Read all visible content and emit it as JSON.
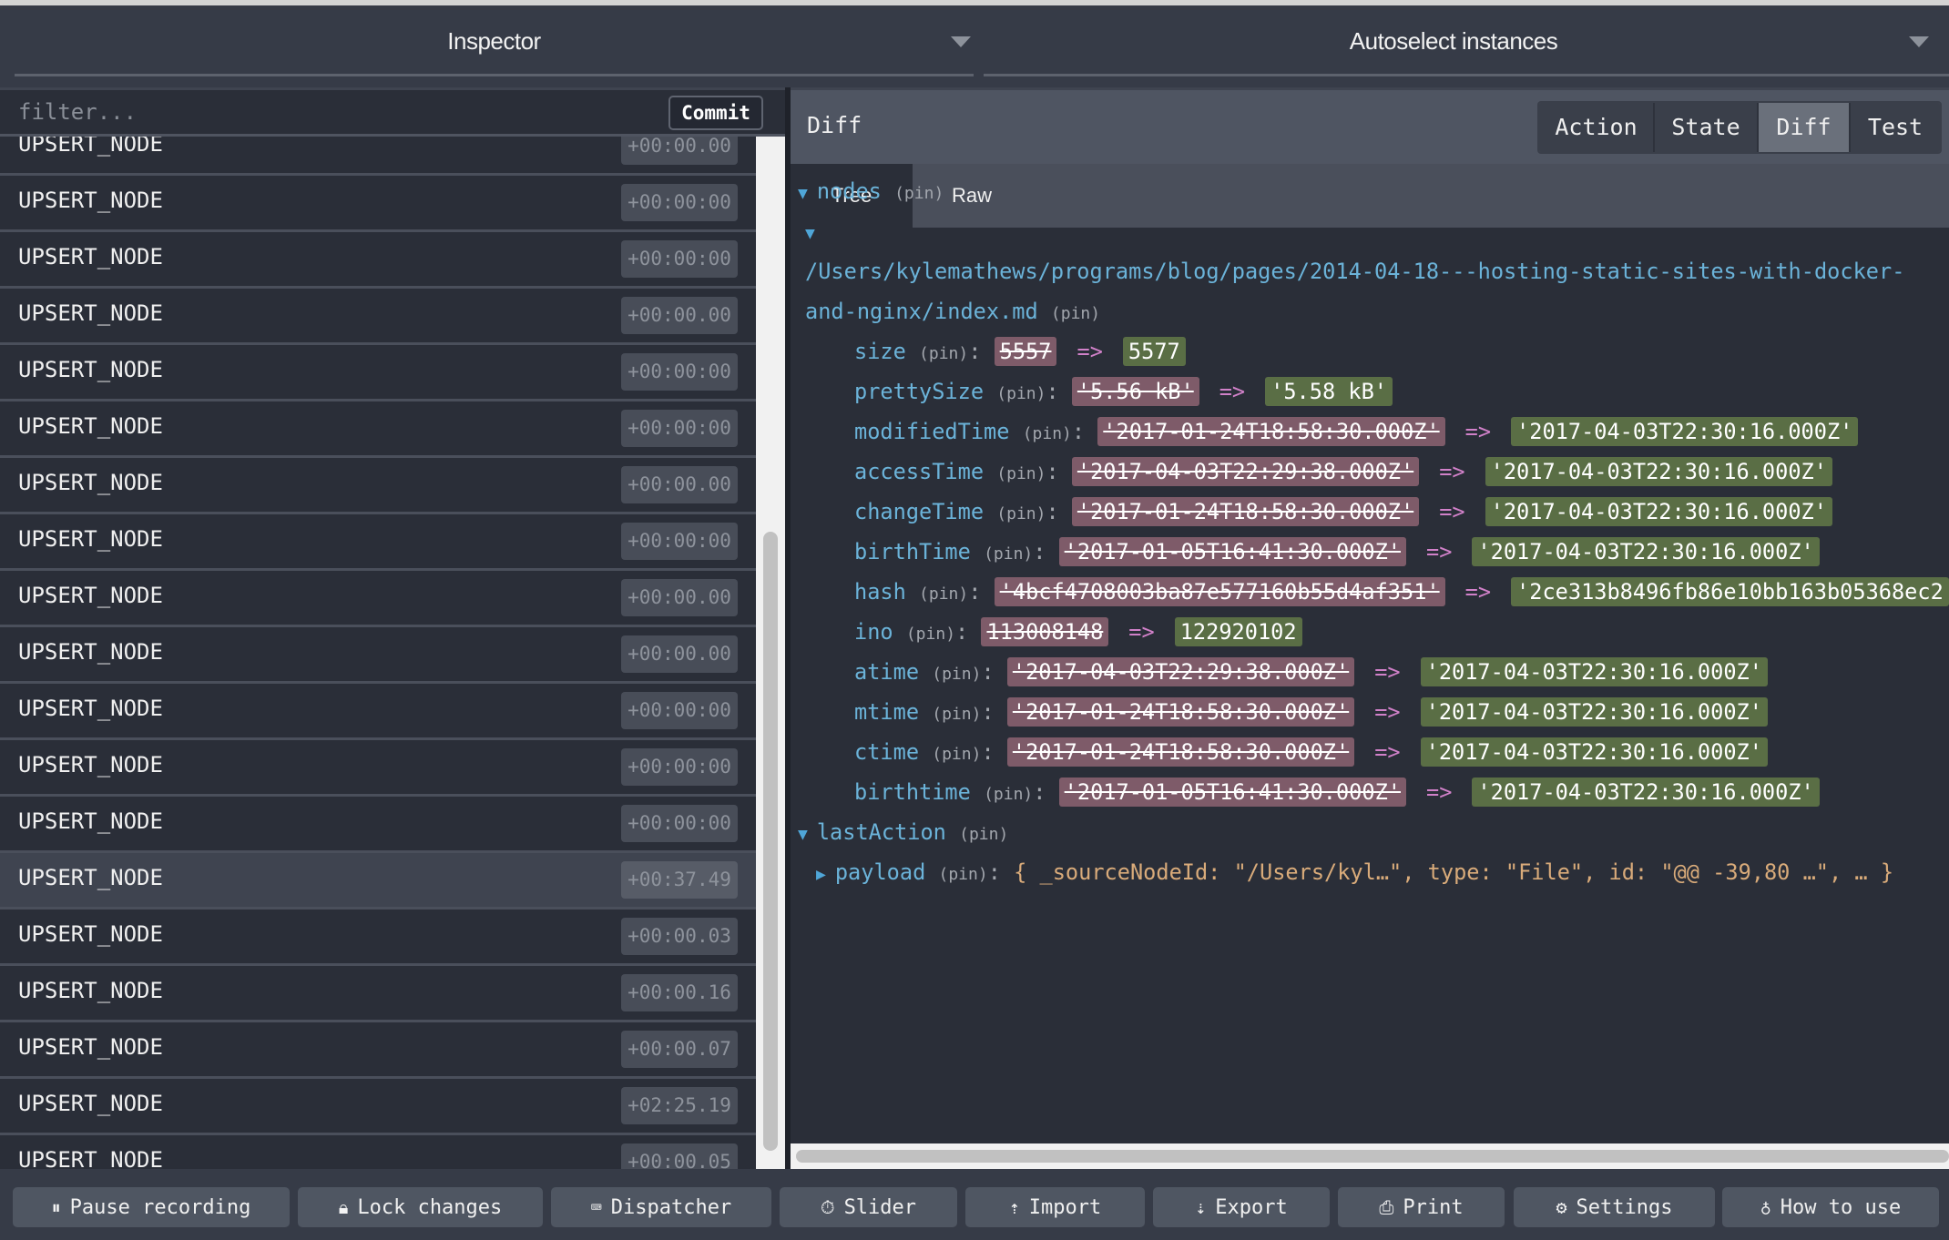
{
  "header": {
    "left_title": "Inspector",
    "right_title": "Autoselect instances"
  },
  "actions": {
    "filter_placeholder": "filter...",
    "commit_label": "Commit",
    "items": [
      {
        "name": "UPSERT_NODE",
        "time": "+00:00.00"
      },
      {
        "name": "UPSERT_NODE",
        "time": "+00:00:00"
      },
      {
        "name": "UPSERT_NODE",
        "time": "+00:00:00"
      },
      {
        "name": "UPSERT_NODE",
        "time": "+00:00.00"
      },
      {
        "name": "UPSERT_NODE",
        "time": "+00:00:00"
      },
      {
        "name": "UPSERT_NODE",
        "time": "+00:00:00"
      },
      {
        "name": "UPSERT_NODE",
        "time": "+00:00.00"
      },
      {
        "name": "UPSERT_NODE",
        "time": "+00:00:00"
      },
      {
        "name": "UPSERT_NODE",
        "time": "+00:00.00"
      },
      {
        "name": "UPSERT_NODE",
        "time": "+00:00.00"
      },
      {
        "name": "UPSERT_NODE",
        "time": "+00:00:00"
      },
      {
        "name": "UPSERT_NODE",
        "time": "+00:00:00"
      },
      {
        "name": "UPSERT_NODE",
        "time": "+00:00:00"
      },
      {
        "name": "UPSERT_NODE",
        "time": "+00:37.49",
        "selected": true
      },
      {
        "name": "UPSERT_NODE",
        "time": "+00:00.03"
      },
      {
        "name": "UPSERT_NODE",
        "time": "+00:00.16"
      },
      {
        "name": "UPSERT_NODE",
        "time": "+00:00.07"
      },
      {
        "name": "UPSERT_NODE",
        "time": "+02:25.19"
      },
      {
        "name": "UPSERT_NODE",
        "time": "+00:00.05"
      }
    ]
  },
  "monitor": {
    "label": "Diff",
    "tabs": [
      "Action",
      "State",
      "Diff",
      "Test"
    ],
    "active_tab": "Diff",
    "subtabs": [
      "Tree",
      "Raw"
    ],
    "active_subtab": "Tree"
  },
  "tree": {
    "pin": "(pin)",
    "arrow": "=>",
    "nodes_key": "nodes",
    "path_line1": "/Users/kylemathews/programs/blog/pages/2014-04-18---hosting-static-sites-with-docker-",
    "path_line2": "and-nginx/index.md",
    "diffs": [
      {
        "key": "size",
        "old": "5557",
        "new": "5577"
      },
      {
        "key": "prettySize",
        "old": "'5.56 kB'",
        "new": "'5.58 kB'"
      },
      {
        "key": "modifiedTime",
        "old": "'2017-01-24T18:58:30.000Z'",
        "new": "'2017-04-03T22:30:16.000Z'"
      },
      {
        "key": "accessTime",
        "old": "'2017-04-03T22:29:38.000Z'",
        "new": "'2017-04-03T22:30:16.000Z'"
      },
      {
        "key": "changeTime",
        "old": "'2017-01-24T18:58:30.000Z'",
        "new": "'2017-04-03T22:30:16.000Z'"
      },
      {
        "key": "birthTime",
        "old": "'2017-01-05T16:41:30.000Z'",
        "new": "'2017-04-03T22:30:16.000Z'"
      },
      {
        "key": "hash",
        "old": "'4bcf4708003ba87e577160b55d4af351'",
        "new": "'2ce313b8496fb86e10bb163b05368ec2"
      },
      {
        "key": "ino",
        "old": "113008148",
        "new": "122920102"
      },
      {
        "key": "atime",
        "old": "'2017-04-03T22:29:38.000Z'",
        "new": "'2017-04-03T22:30:16.000Z'"
      },
      {
        "key": "mtime",
        "old": "'2017-01-24T18:58:30.000Z'",
        "new": "'2017-04-03T22:30:16.000Z'"
      },
      {
        "key": "ctime",
        "old": "'2017-01-24T18:58:30.000Z'",
        "new": "'2017-04-03T22:30:16.000Z'"
      },
      {
        "key": "birthtime",
        "old": "'2017-01-05T16:41:30.000Z'",
        "new": "'2017-04-03T22:30:16.000Z'"
      }
    ],
    "last_action_key": "lastAction",
    "payload_key": "payload",
    "payload_value": "{ _sourceNodeId: \"/Users/kyl…\", type: \"File\", id: \"@@ -39,80 …\", … }"
  },
  "footer": {
    "buttons": [
      {
        "label": "Pause recording",
        "icon": "pause-icon"
      },
      {
        "label": "Lock changes",
        "icon": "lock-icon"
      },
      {
        "label": "Dispatcher",
        "icon": "keyboard-icon"
      },
      {
        "label": "Slider",
        "icon": "stopwatch-icon"
      },
      {
        "label": "Import",
        "icon": "upload-icon"
      },
      {
        "label": "Export",
        "icon": "download-icon"
      },
      {
        "label": "Print",
        "icon": "print-icon"
      },
      {
        "label": "Settings",
        "icon": "gear-icon"
      },
      {
        "label": "How to use",
        "icon": "lightbulb-icon"
      }
    ]
  },
  "colors": {
    "removed_bg": "#7e5b69",
    "added_bg": "#5a6e45",
    "key": "#6bb3d9",
    "arrow": "#d181c9"
  }
}
